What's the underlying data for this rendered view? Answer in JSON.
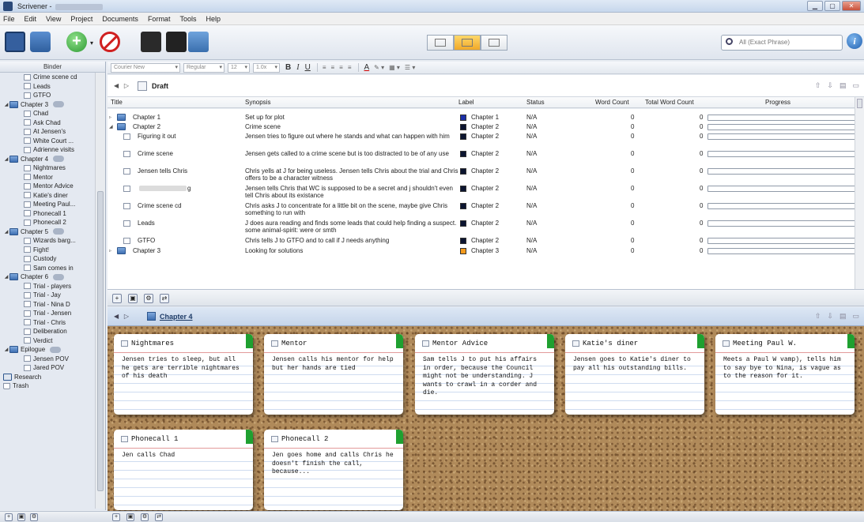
{
  "window": {
    "title": "Scrivener -"
  },
  "menu": [
    "File",
    "Edit",
    "View",
    "Project",
    "Documents",
    "Format",
    "Tools",
    "Help"
  ],
  "search": {
    "placeholder": "All (Exact Phrase)"
  },
  "binder": {
    "header": "Binder",
    "items": [
      {
        "label": "Crime scene cd",
        "type": "doc",
        "level": 1
      },
      {
        "label": "Leads",
        "type": "doc",
        "level": 1
      },
      {
        "label": "GTFO",
        "type": "doc",
        "level": 1
      },
      {
        "label": "Chapter 3",
        "type": "folder",
        "level": 0,
        "expanded": true
      },
      {
        "label": "Chad",
        "type": "doc",
        "level": 1
      },
      {
        "label": "Ask Chad",
        "type": "doc",
        "level": 1
      },
      {
        "label": "At Jensen's",
        "type": "doc",
        "level": 1
      },
      {
        "label": "White Court ...",
        "type": "doc",
        "level": 1
      },
      {
        "label": "Adrienne visits",
        "type": "doc",
        "level": 1
      },
      {
        "label": "Chapter 4",
        "type": "folder",
        "level": 0,
        "expanded": true
      },
      {
        "label": "Nightmares",
        "type": "doc",
        "level": 1
      },
      {
        "label": "Mentor",
        "type": "doc",
        "level": 1
      },
      {
        "label": "Mentor Advice",
        "type": "doc",
        "level": 1
      },
      {
        "label": "Katie's diner",
        "type": "doc",
        "level": 1
      },
      {
        "label": "Meeting Paul...",
        "type": "doc",
        "level": 1
      },
      {
        "label": "Phonecall 1",
        "type": "doc",
        "level": 1
      },
      {
        "label": "Phonecall 2",
        "type": "doc",
        "level": 1
      },
      {
        "label": "Chapter 5",
        "type": "folder",
        "level": 0,
        "expanded": true
      },
      {
        "label": "Wizards barg...",
        "type": "doc",
        "level": 1
      },
      {
        "label": "Fight!",
        "type": "doc",
        "level": 1
      },
      {
        "label": "Custody",
        "type": "doc",
        "level": 1
      },
      {
        "label": "Sam comes in",
        "type": "doc",
        "level": 1
      },
      {
        "label": "Chapter 6",
        "type": "folder",
        "level": 0,
        "expanded": true
      },
      {
        "label": "Trial - players",
        "type": "doc",
        "level": 1
      },
      {
        "label": "Trial - Jay",
        "type": "doc",
        "level": 1
      },
      {
        "label": "Trial - Nina D",
        "type": "doc",
        "level": 1
      },
      {
        "label": "Trial - Jensen",
        "type": "doc",
        "level": 1
      },
      {
        "label": "Trial - Chris",
        "type": "doc",
        "level": 1
      },
      {
        "label": "Deliberation",
        "type": "doc",
        "level": 1
      },
      {
        "label": "Verdict",
        "type": "doc",
        "level": 1
      },
      {
        "label": "Epilogue",
        "type": "folder",
        "level": 0,
        "expanded": true
      },
      {
        "label": "Jensen POV",
        "type": "doc",
        "level": 1
      },
      {
        "label": "Jared POV",
        "type": "doc",
        "level": 1
      },
      {
        "label": "Research",
        "type": "research",
        "level": 0
      },
      {
        "label": "Trash",
        "type": "trash",
        "level": 0
      }
    ]
  },
  "format": {
    "font": "Courier New",
    "style": "Regular",
    "size": "12",
    "spacing": "1.0x"
  },
  "outliner": {
    "title": "Draft",
    "columns": {
      "title": "Title",
      "synopsis": "Synopsis",
      "label": "Label",
      "status": "Status",
      "word_count": "Word Count",
      "total_word_count": "Total Word Count",
      "progress": "Progress"
    },
    "rows": [
      {
        "title": "Chapter 1",
        "kind": "folder",
        "level": 0,
        "tri": "▹",
        "synopsis": "Set up for plot",
        "label": "Chapter 1",
        "label_color": "#1c2fa8",
        "status": "N/A",
        "wc": "0",
        "twc": "0"
      },
      {
        "title": "Chapter 2",
        "kind": "folder",
        "level": 0,
        "tri": "◢",
        "synopsis": "Crime scene",
        "label": "Chapter 2",
        "label_color": "#0c1530",
        "status": "N/A",
        "wc": "0",
        "twc": "0"
      },
      {
        "title": "Figuring it out",
        "kind": "doc",
        "level": 1,
        "tri": "",
        "synopsis": "Jensen tries to figure out where he stands and what can happen with him",
        "label": "Chapter 2",
        "label_color": "#0c1530",
        "status": "N/A",
        "wc": "0",
        "twc": "0"
      },
      {
        "title": "Crime scene",
        "kind": "doc",
        "level": 1,
        "tri": "",
        "synopsis": "Jensen gets called to a crime scene but is too distracted to be of any use",
        "label": "Chapter 2",
        "label_color": "#0c1530",
        "status": "N/A",
        "wc": "0",
        "twc": "0"
      },
      {
        "title": "Jensen tells Chris",
        "kind": "doc",
        "level": 1,
        "tri": "",
        "synopsis": "Chris yells at J for being useless. Jensen tells Chris about the trial and Chris offers to be a character witness",
        "label": "Chapter 2",
        "label_color": "#0c1530",
        "status": "N/A",
        "wc": "0",
        "twc": "0"
      },
      {
        "title": "g",
        "kind": "doc",
        "level": 1,
        "tri": "",
        "blurred": true,
        "synopsis": "Jensen tells Chris that WC is supposed to be a secret and j shouldn't even tell Chris about its existance",
        "label": "Chapter 2",
        "label_color": "#0c1530",
        "status": "N/A",
        "wc": "0",
        "twc": "0"
      },
      {
        "title": "Crime scene cd",
        "kind": "doc",
        "level": 1,
        "tri": "",
        "synopsis": "Chris asks J to concentrate for a little bit on the scene, maybe give Chris something to run with",
        "label": "Chapter 2",
        "label_color": "#0c1530",
        "status": "N/A",
        "wc": "0",
        "twc": "0"
      },
      {
        "title": "Leads",
        "kind": "doc",
        "level": 1,
        "tri": "",
        "synopsis": "J does aura reading and finds some leads that could help finding a suspect. some animal-spirit: were or smth",
        "label": "Chapter 2",
        "label_color": "#0c1530",
        "status": "N/A",
        "wc": "0",
        "twc": "0"
      },
      {
        "title": "GTFO",
        "kind": "doc",
        "level": 1,
        "tri": "",
        "synopsis": "Chris tells J to GTFO and to call if J needs anything",
        "label": "Chapter 2",
        "label_color": "#0c1530",
        "status": "N/A",
        "wc": "0",
        "twc": "0"
      },
      {
        "title": "Chapter 3",
        "kind": "folder",
        "level": 0,
        "tri": "▹",
        "synopsis": "Looking for solutions",
        "label": "Chapter 3",
        "label_color": "#f49a1c",
        "status": "N/A",
        "wc": "0",
        "twc": "0"
      }
    ]
  },
  "corkboard": {
    "title": "Chapter 4",
    "cards": [
      {
        "title": "Nightmares",
        "text": "Jensen tries to sleep, but all he gets are terrible nightmares of his death"
      },
      {
        "title": "Mentor",
        "text": "Jensen calls his mentor for help but her hands are tied"
      },
      {
        "title": "Mentor Advice",
        "text": "Sam tells J to put his affairs in order, because the Council might not be understanding. J wants to crawl in a corder and die."
      },
      {
        "title": "Katie's diner",
        "text": "Jensen goes to Katie's diner to pay all his outstanding bills."
      },
      {
        "title": "Meeting Paul W.",
        "text": "Meets a Paul W vamp), tells him to say bye to Nina, is vague as to the reason for it."
      },
      {
        "title": "Phonecall 1",
        "text": "Jen calls Chad"
      },
      {
        "title": "Phonecall 2",
        "text": "Jen goes home and calls Chris he doesn't finish the call, because..."
      }
    ]
  }
}
